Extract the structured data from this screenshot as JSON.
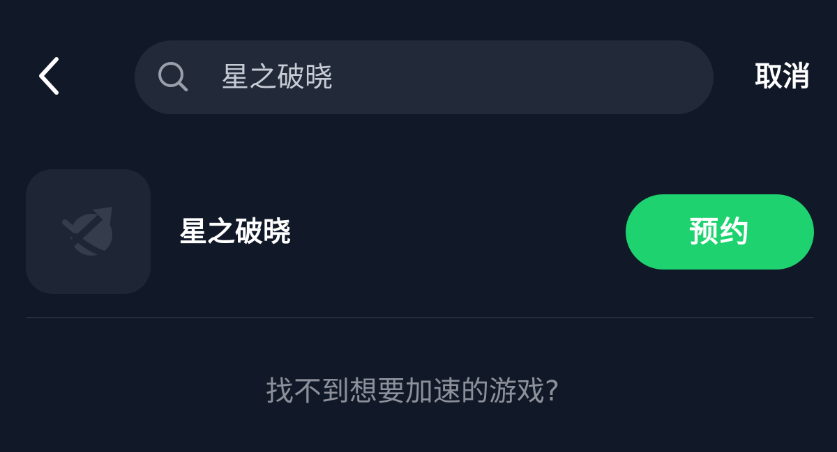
{
  "header": {
    "search": {
      "value": "星之破晓"
    },
    "cancel_label": "取消"
  },
  "result": {
    "title": "星之破晓",
    "action_label": "预约",
    "action_color": "#1ed26f"
  },
  "hint": {
    "text": "找不到想要加速的游戏?"
  },
  "colors": {
    "background": "#111827",
    "search_bg": "#222a3a",
    "icon_tile": "#1e2535"
  },
  "icons": [
    "back-arrow",
    "search-icon",
    "game-placeholder-icon"
  ]
}
